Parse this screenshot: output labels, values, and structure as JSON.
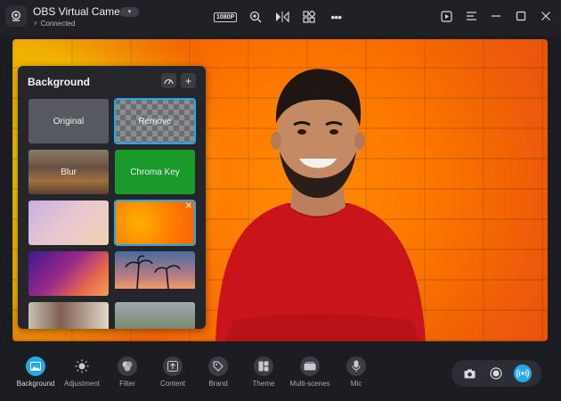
{
  "header": {
    "app_title": "OBS Virtual Camera",
    "status": "Connected",
    "resolution_badge": "1080P"
  },
  "panel": {
    "title": "Background",
    "tiles": [
      {
        "label": "Original"
      },
      {
        "label": "Remove"
      },
      {
        "label": "Blur"
      },
      {
        "label": "Chroma Key"
      }
    ]
  },
  "toolbar": {
    "items": [
      {
        "label": "Background"
      },
      {
        "label": "Adjustment"
      },
      {
        "label": "Filter"
      },
      {
        "label": "Content"
      },
      {
        "label": "Brand"
      },
      {
        "label": "Theme"
      },
      {
        "label": "Multi-scenes"
      },
      {
        "label": "Mic"
      }
    ]
  },
  "colors": {
    "accent": "#27a8e8",
    "chroma_green": "#1a9a2a",
    "panel_bg": "#24262b"
  }
}
